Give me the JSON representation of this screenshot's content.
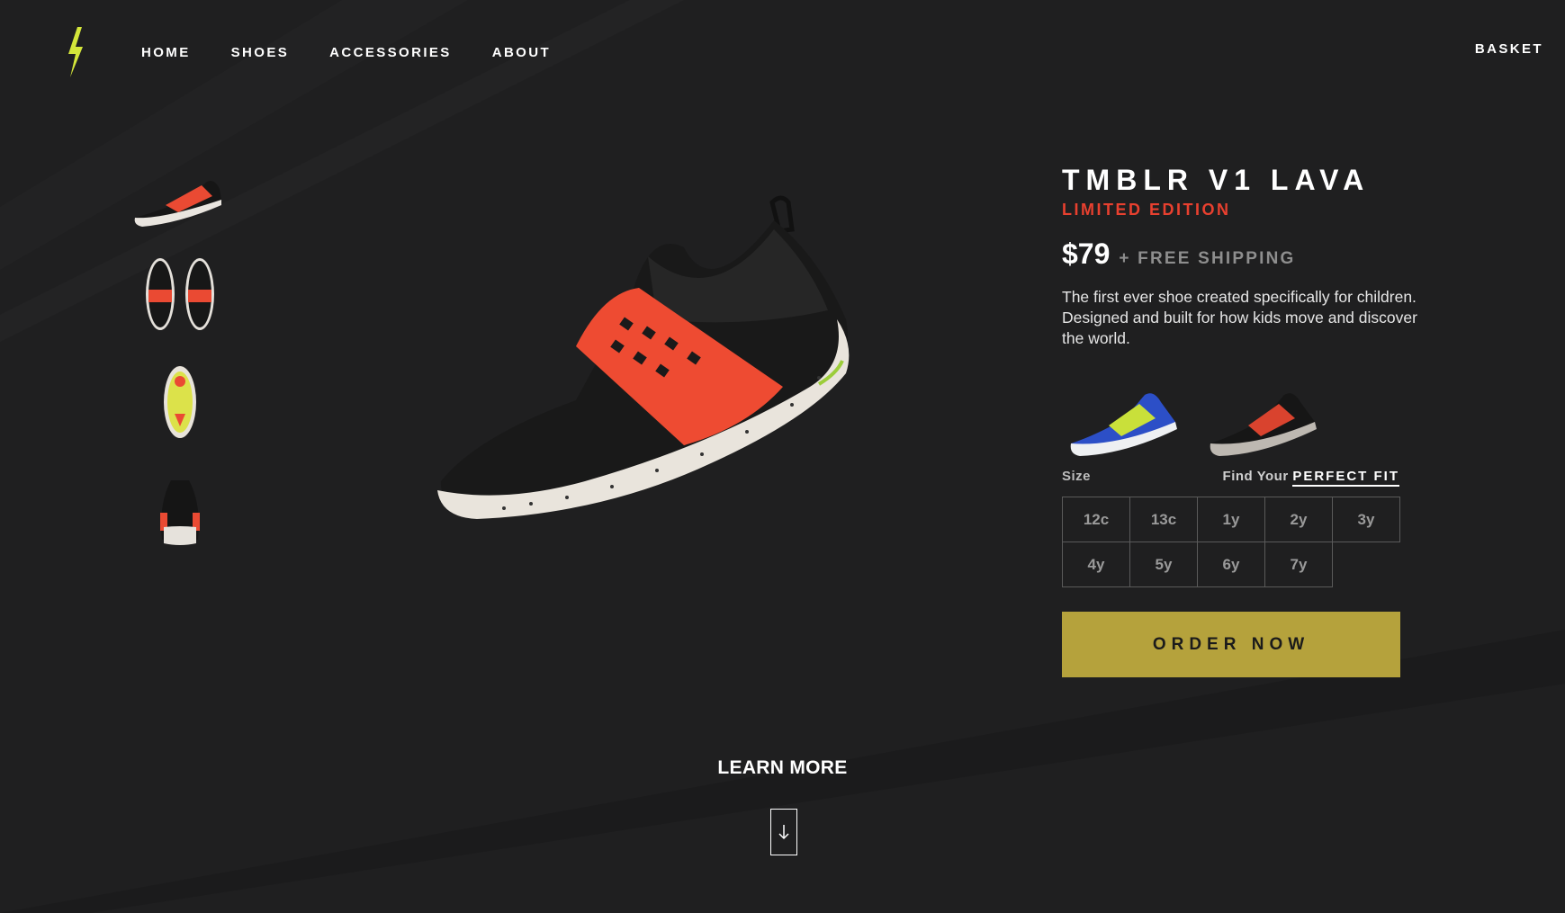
{
  "colors": {
    "background": "#1f1f20",
    "accent_yellow": "#d4e63a",
    "edition_red": "#e8402f",
    "order_button": "#b5a23c"
  },
  "header": {
    "logo_icon": "lightning-bolt-icon",
    "nav": [
      {
        "label": "HOME"
      },
      {
        "label": "SHOES"
      },
      {
        "label": "ACCESSORIES"
      },
      {
        "label": "ABOUT"
      }
    ],
    "basket_label": "BASKET"
  },
  "gallery": {
    "thumbnails": [
      "side-view",
      "top-view",
      "sole-view",
      "back-view"
    ]
  },
  "product": {
    "title": "TMBLR V1 LAVA",
    "edition": "LIMITED EDITION",
    "price": "$79",
    "shipping": "+ FREE SHIPPING",
    "description": "The first ever shoe created specifically for children. Designed and built for how kids move and discover the world.",
    "colorways": [
      "blue-lime",
      "black-lava"
    ],
    "size_label": "Size",
    "fit_prefix": "Find Your",
    "fit_link": "PERFECT FIT",
    "sizes": [
      "12c",
      "13c",
      "1y",
      "2y",
      "3y",
      "4y",
      "5y",
      "6y",
      "7y"
    ],
    "order_label": "ORDER NOW"
  },
  "footer": {
    "learn_more": "LEARN MORE",
    "arrow_icon": "arrow-down-icon"
  }
}
